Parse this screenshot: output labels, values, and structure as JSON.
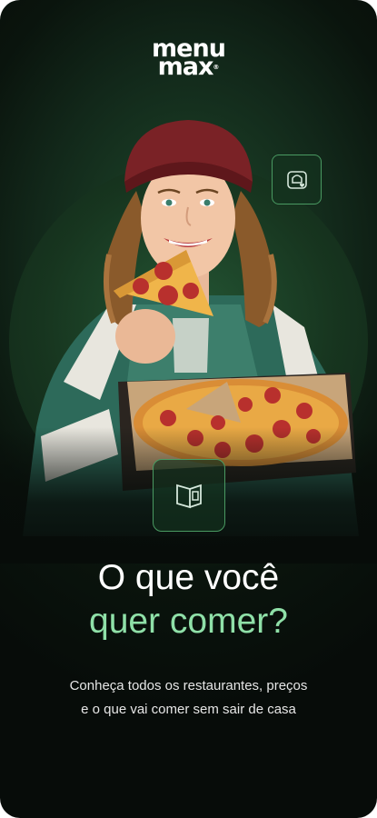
{
  "brand": {
    "line1": "menu",
    "line2": "max",
    "registered": "®"
  },
  "icons": {
    "top_badge": "dish-heart-icon",
    "center_badge": "menu-book-icon"
  },
  "hero": {
    "subject": "woman-eating-pepperoni-pizza"
  },
  "headline": {
    "line1": "O que você",
    "line2": "quer comer?"
  },
  "subtitle": {
    "line1": "Conheça todos os restaurantes, preços",
    "line2": "e o que vai comer sem sair de casa"
  },
  "colors": {
    "accent": "#8fe0a8",
    "background": "#070c09",
    "badge_border": "#4a9a62"
  }
}
